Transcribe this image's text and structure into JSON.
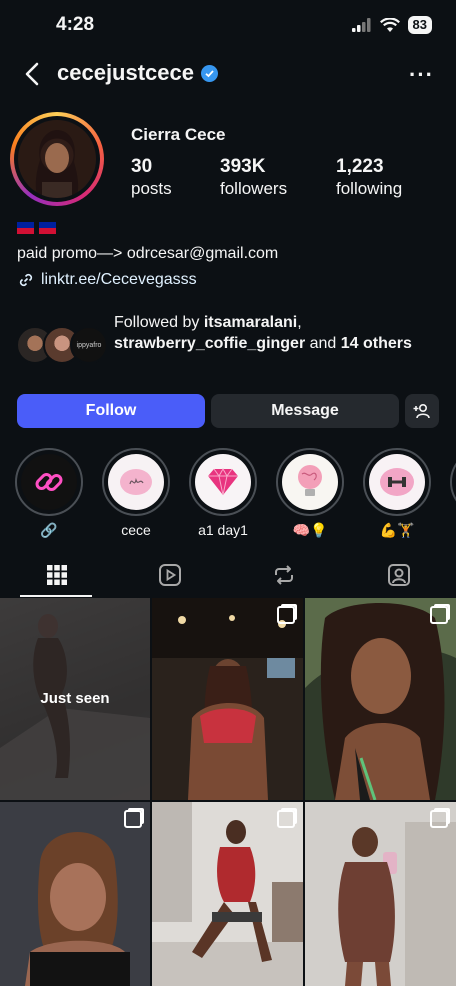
{
  "status_bar": {
    "time": "4:28",
    "battery": "83"
  },
  "header": {
    "username": "cecejustcece",
    "more": "···"
  },
  "profile": {
    "display_name": "Cierra Cece",
    "stats": [
      {
        "value": "30",
        "label": "posts"
      },
      {
        "value": "393K",
        "label": "followers"
      },
      {
        "value": "1,223",
        "label": "following"
      }
    ],
    "bio": "paid promo—> odrcesar@gmail.com",
    "link": "linktr.ee/Cecevegasss"
  },
  "followed_by": {
    "prefix": "Followed by ",
    "user1": "itsamaralani",
    "sep": ",",
    "user2": "strawberry_coffie_ginger",
    "mid": " and ",
    "others": "14 others",
    "mini_avatar_text": "ippyafro"
  },
  "actions": {
    "follow": "Follow",
    "message": "Message"
  },
  "highlights": [
    {
      "label": "🔗",
      "icon": "link-icon"
    },
    {
      "label": "cece",
      "icon": "signature-icon"
    },
    {
      "label": "a1 day1",
      "icon": "diamond-icon"
    },
    {
      "label": "🧠💡",
      "icon": "lightbulb-icon"
    },
    {
      "label": "💪🏋",
      "icon": "dumbbell-icon"
    }
  ],
  "tabs": [
    "grid-icon",
    "reels-icon",
    "reposts-icon",
    "tagged-icon"
  ],
  "grid": {
    "seen_label": "Just seen"
  },
  "colors": {
    "accent": "#4a5df9",
    "background": "#0c1014",
    "verified": "#3797f0"
  }
}
